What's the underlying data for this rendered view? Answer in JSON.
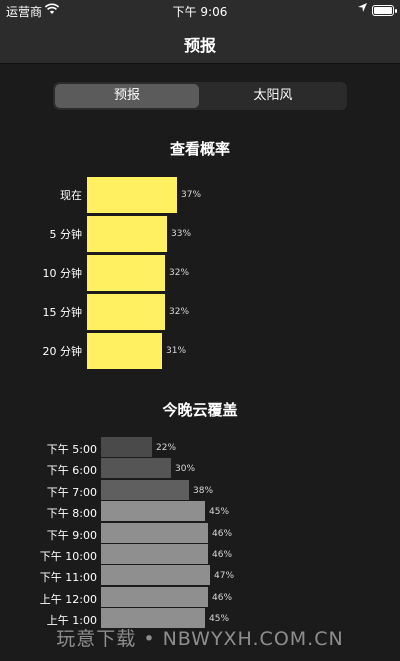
{
  "status": {
    "carrier": "运营商",
    "time": "下午 9:06"
  },
  "nav": {
    "title": "预报"
  },
  "tabs": [
    {
      "label": "预报",
      "selected": true
    },
    {
      "label": "太阳风",
      "selected": false
    }
  ],
  "probability": {
    "title": "查看概率",
    "bar_color": "#fef060",
    "rows": [
      {
        "label": "现在",
        "value": 37,
        "text": "37%"
      },
      {
        "label": "5 分钟",
        "value": 33,
        "text": "33%"
      },
      {
        "label": "10 分钟",
        "value": 32,
        "text": "32%"
      },
      {
        "label": "15 分钟",
        "value": 32,
        "text": "32%"
      },
      {
        "label": "20 分钟",
        "value": 31,
        "text": "31%"
      }
    ]
  },
  "cloud": {
    "title": "今晚云覆盖",
    "rows": [
      {
        "label": "下午 5:00",
        "value": 22,
        "text": "22%",
        "color": "#4a4a4a"
      },
      {
        "label": "下午 6:00",
        "value": 30,
        "text": "30%",
        "color": "#555555"
      },
      {
        "label": "下午 7:00",
        "value": 38,
        "text": "38%",
        "color": "#5f5f5f"
      },
      {
        "label": "下午 8:00",
        "value": 45,
        "text": "45%",
        "color": "#8f8f8f"
      },
      {
        "label": "下午 9:00",
        "value": 46,
        "text": "46%",
        "color": "#8f8f8f"
      },
      {
        "label": "下午 10:00",
        "value": 46,
        "text": "46%",
        "color": "#8f8f8f"
      },
      {
        "label": "下午 11:00",
        "value": 47,
        "text": "47%",
        "color": "#8f8f8f"
      },
      {
        "label": "上午 12:00",
        "value": 46,
        "text": "46%",
        "color": "#8f8f8f"
      },
      {
        "label": "上午 1:00",
        "value": 45,
        "text": "45%",
        "color": "#8f8f8f"
      }
    ]
  },
  "watermark": "玩意下载 • NBWYXH.COM.CN"
}
